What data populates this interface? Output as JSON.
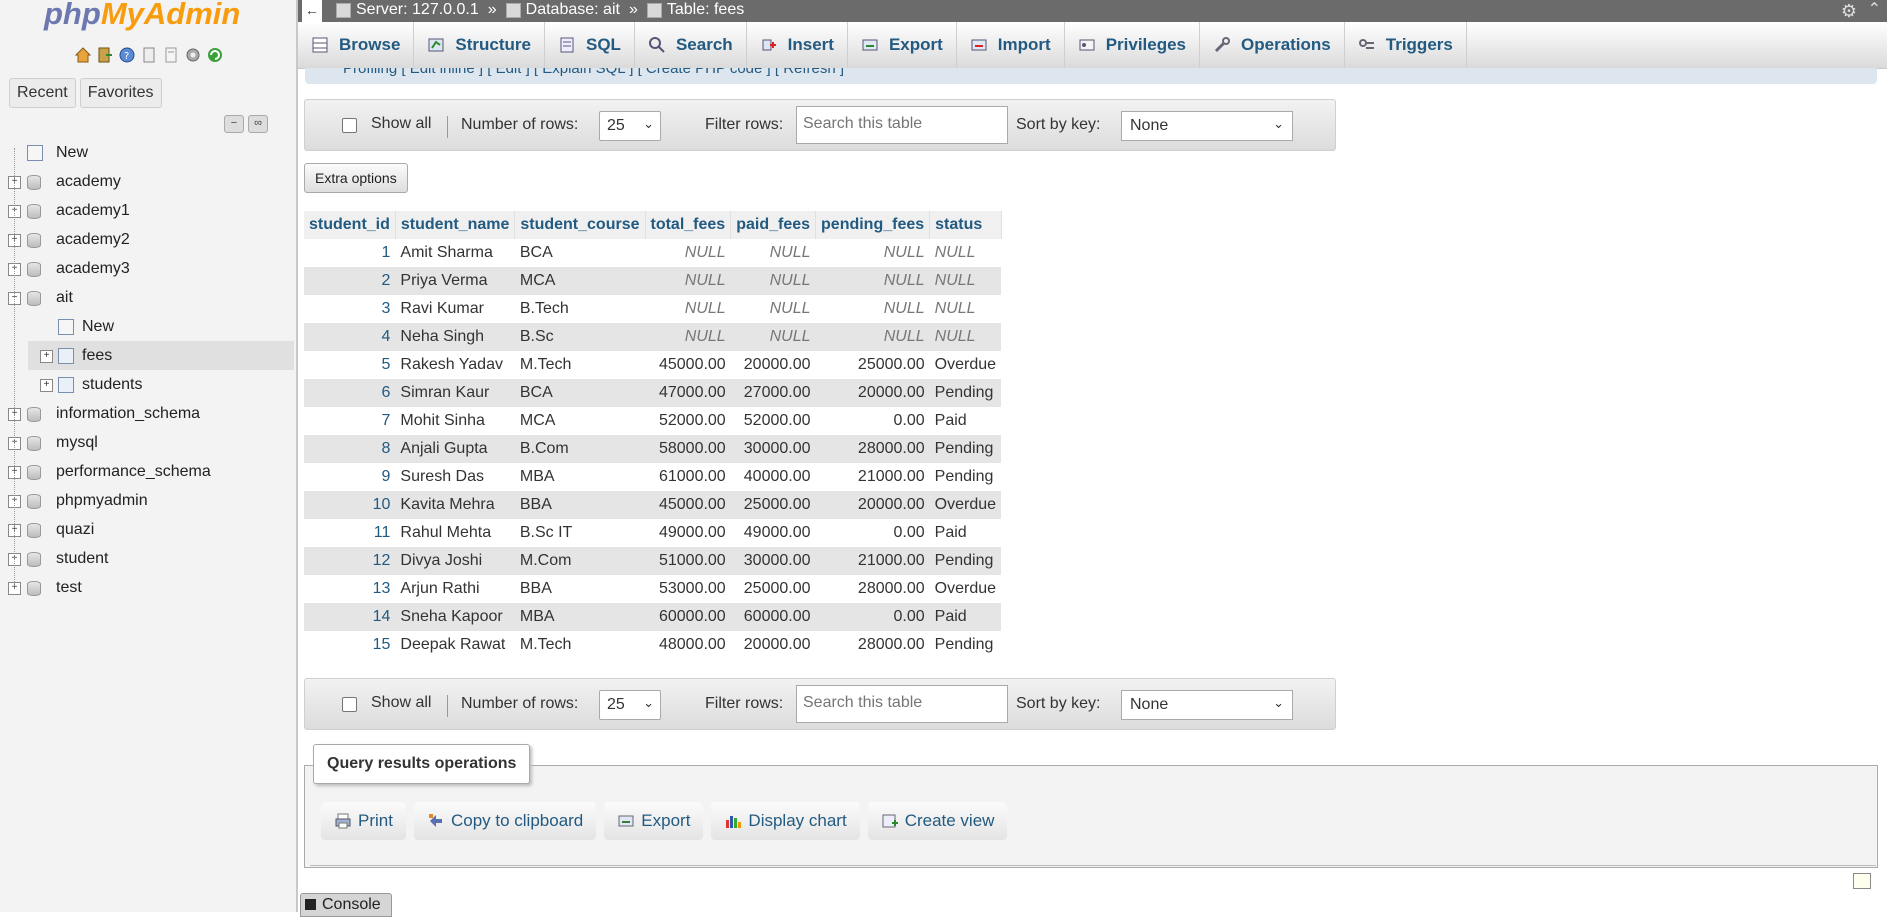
{
  "app": {
    "logo_part1": "php",
    "logo_part2": "MyAdmin"
  },
  "nav": {
    "tabs": [
      "Recent",
      "Favorites"
    ],
    "tree": [
      {
        "label": "New",
        "type": "new"
      },
      {
        "label": "academy",
        "type": "db"
      },
      {
        "label": "academy1",
        "type": "db"
      },
      {
        "label": "academy2",
        "type": "db"
      },
      {
        "label": "academy3",
        "type": "db"
      },
      {
        "label": "ait",
        "type": "db-open"
      },
      {
        "label": "New",
        "type": "new-child"
      },
      {
        "label": "fees",
        "type": "table"
      },
      {
        "label": "students",
        "type": "table"
      },
      {
        "label": "information_schema",
        "type": "db"
      },
      {
        "label": "mysql",
        "type": "db"
      },
      {
        "label": "performance_schema",
        "type": "db"
      },
      {
        "label": "phpmyadmin",
        "type": "db"
      },
      {
        "label": "quazi",
        "type": "db"
      },
      {
        "label": "student",
        "type": "db"
      },
      {
        "label": "test",
        "type": "db"
      }
    ]
  },
  "breadcrumb": {
    "server": "Server: 127.0.0.1",
    "database": "Database: ait",
    "table": "Table: fees",
    "separator": "»"
  },
  "tabs": [
    "Browse",
    "Structure",
    "SQL",
    "Search",
    "Insert",
    "Export",
    "Import",
    "Privileges",
    "Operations",
    "Triggers"
  ],
  "tabs_under_text": "Profiling [ Edit inline ] [ Edit ] [ Explain SQL ] [ Create PHP code ] [ Refresh ]",
  "navbar": {
    "show_all": "Show all",
    "rows_label": "Number of rows:",
    "rows_value": "25",
    "filter_label": "Filter rows:",
    "filter_placeholder": "Search this table",
    "sort_label": "Sort by key:",
    "sort_value": "None"
  },
  "extra_options": "Extra options",
  "table": {
    "columns": [
      "student_id",
      "student_name",
      "student_course",
      "total_fees",
      "paid_fees",
      "pending_fees",
      "status"
    ],
    "rows": [
      [
        "1",
        "Amit Sharma",
        "BCA",
        "NULL",
        "NULL",
        "NULL",
        "NULL"
      ],
      [
        "2",
        "Priya Verma",
        "MCA",
        "NULL",
        "NULL",
        "NULL",
        "NULL"
      ],
      [
        "3",
        "Ravi Kumar",
        "B.Tech",
        "NULL",
        "NULL",
        "NULL",
        "NULL"
      ],
      [
        "4",
        "Neha Singh",
        "B.Sc",
        "NULL",
        "NULL",
        "NULL",
        "NULL"
      ],
      [
        "5",
        "Rakesh Yadav",
        "M.Tech",
        "45000.00",
        "20000.00",
        "25000.00",
        "Overdue"
      ],
      [
        "6",
        "Simran Kaur",
        "BCA",
        "47000.00",
        "27000.00",
        "20000.00",
        "Pending"
      ],
      [
        "7",
        "Mohit Sinha",
        "MCA",
        "52000.00",
        "52000.00",
        "0.00",
        "Paid"
      ],
      [
        "8",
        "Anjali Gupta",
        "B.Com",
        "58000.00",
        "30000.00",
        "28000.00",
        "Pending"
      ],
      [
        "9",
        "Suresh Das",
        "MBA",
        "61000.00",
        "40000.00",
        "21000.00",
        "Pending"
      ],
      [
        "10",
        "Kavita Mehra",
        "BBA",
        "45000.00",
        "25000.00",
        "20000.00",
        "Overdue"
      ],
      [
        "11",
        "Rahul Mehta",
        "B.Sc IT",
        "49000.00",
        "49000.00",
        "0.00",
        "Paid"
      ],
      [
        "12",
        "Divya Joshi",
        "M.Com",
        "51000.00",
        "30000.00",
        "21000.00",
        "Pending"
      ],
      [
        "13",
        "Arjun Rathi",
        "BBA",
        "53000.00",
        "25000.00",
        "28000.00",
        "Overdue"
      ],
      [
        "14",
        "Sneha Kapoor",
        "MBA",
        "60000.00",
        "60000.00",
        "0.00",
        "Paid"
      ],
      [
        "15",
        "Deepak Rawat",
        "M.Tech",
        "48000.00",
        "20000.00",
        "28000.00",
        "Pending"
      ]
    ]
  },
  "query_ops": {
    "legend": "Query results operations",
    "actions": [
      "Print",
      "Copy to clipboard",
      "Export",
      "Display chart",
      "Create view"
    ]
  },
  "console": "Console",
  "colors": {
    "link": "#235a81",
    "logo_php": "#6c78af",
    "logo_myadmin": "#f89c0e",
    "topbar": "#6b6b6b"
  }
}
